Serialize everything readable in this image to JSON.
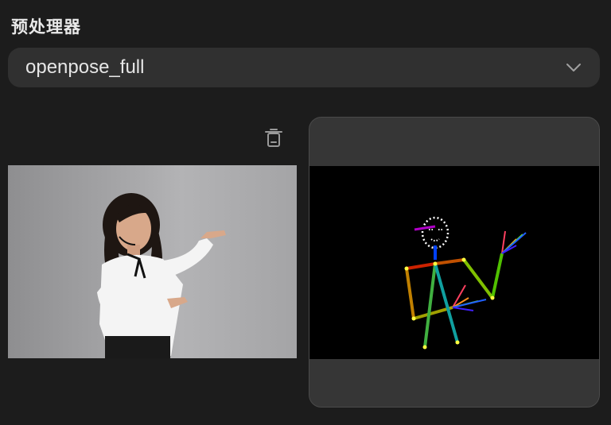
{
  "section": {
    "title": "预处理器"
  },
  "preprocessor_select": {
    "value": "openpose_full"
  },
  "icons": {
    "dropdown": "chevron-down-icon",
    "delete": "trash-icon"
  },
  "colors": {
    "background": "#1c1c1c",
    "control": "#303030",
    "card": "#363636",
    "text": "#e6e6e6",
    "icon": "#a0a0a0"
  }
}
